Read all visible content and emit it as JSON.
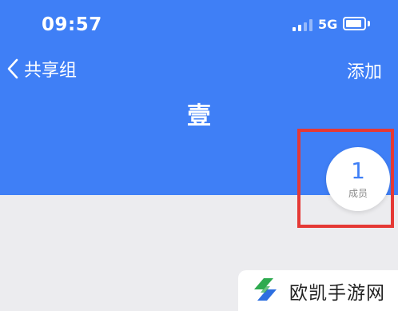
{
  "status_bar": {
    "time": "09:57",
    "network": "5G",
    "signal_icon": "signal-bars-icon",
    "battery_icon": "battery-icon"
  },
  "nav": {
    "back_icon": "chevron-left-icon",
    "back_label": "共享组",
    "add_label": "添加"
  },
  "group": {
    "name": "壹",
    "member_count": "1",
    "member_label": "成员"
  },
  "watermark": {
    "text": "欧凯手游网",
    "logo_icon": "brand-logo-icon"
  },
  "colors": {
    "header_blue": "#3f7ff6",
    "page_background": "#ececef",
    "highlight_red": "#e53935",
    "logo_green": "#2eaa4f",
    "logo_blue": "#2d6fe0"
  }
}
